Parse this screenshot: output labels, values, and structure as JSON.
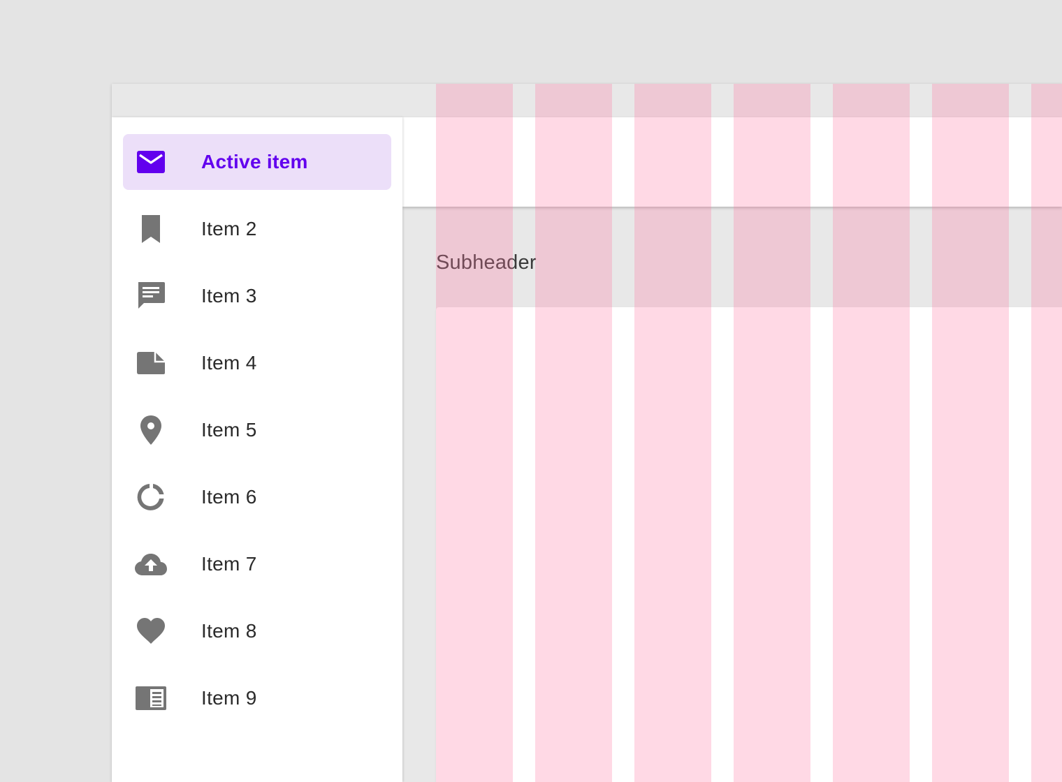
{
  "colors": {
    "page_background": "#e4e4e4",
    "surface": "#ffffff",
    "active_accent": "#6200ee",
    "active_background": "#ecdff9",
    "icon_gray": "#757575",
    "grid_overlay": "#ff78a0"
  },
  "nav_drawer": {
    "items": [
      {
        "label": "Active item",
        "icon": "mail-icon",
        "active": true
      },
      {
        "label": "Item 2",
        "icon": "bookmark-icon",
        "active": false
      },
      {
        "label": "Item 3",
        "icon": "chat-message-icon",
        "active": false
      },
      {
        "label": "Item 4",
        "icon": "note-icon",
        "active": false
      },
      {
        "label": "Item 5",
        "icon": "location-pin-icon",
        "active": false
      },
      {
        "label": "Item 6",
        "icon": "donut-chart-icon",
        "active": false
      },
      {
        "label": "Item 7",
        "icon": "cloud-upload-icon",
        "active": false
      },
      {
        "label": "Item 8",
        "icon": "heart-icon",
        "active": false
      },
      {
        "label": "Item 9",
        "icon": "reader-icon",
        "active": false
      }
    ]
  },
  "main": {
    "subheader": "Subheader"
  }
}
